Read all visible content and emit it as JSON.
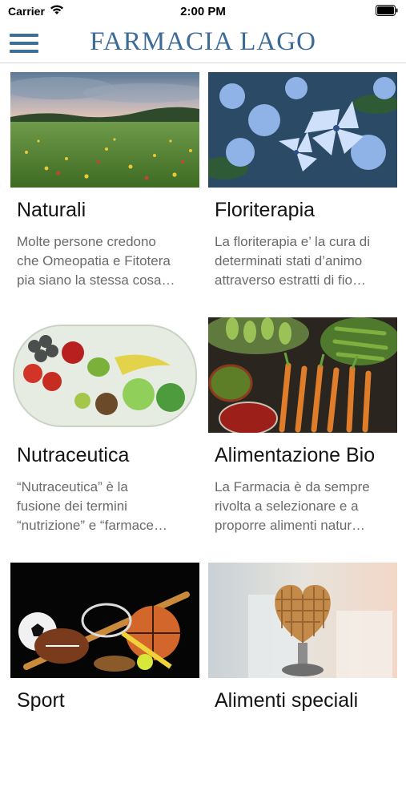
{
  "status_bar": {
    "carrier": "Carrier",
    "time": "2:00 PM"
  },
  "header": {
    "title": "FARMACIA LAGO"
  },
  "cards": [
    {
      "title": "Naturali",
      "description": "Molte persone credono\nche Omeopatia e Fitotera\npia siano la stessa cosa…",
      "image": "meadow-photo"
    },
    {
      "title": "Floriterapia",
      "description": "La floriterapia e’ la cura di\ndeterminati stati d’animo\nattraverso estratti di fio…",
      "image": "blue-flowers-photo"
    },
    {
      "title": "Nutraceutica",
      "description": "“Nutraceutica” è la\n fusione dei termini\n“nutrizione” e “farmace…",
      "image": "fruit-capsule-photo"
    },
    {
      "title": "Alimentazione Bio",
      "description": "La Farmacia  è da sempre\nrivolta a selezionare e a\nproporre alimenti natur…",
      "image": "vegetables-photo"
    },
    {
      "title": "Sport",
      "description": "",
      "image": "sport-balls-photo"
    },
    {
      "title": "Alimenti speciali",
      "description": "",
      "image": "heart-waffle-photo"
    }
  ],
  "colors": {
    "brand": "#3c6b98",
    "menu_icon": "#3e6f99",
    "title_text": "#141414",
    "description_text": "#6a6a6a"
  }
}
